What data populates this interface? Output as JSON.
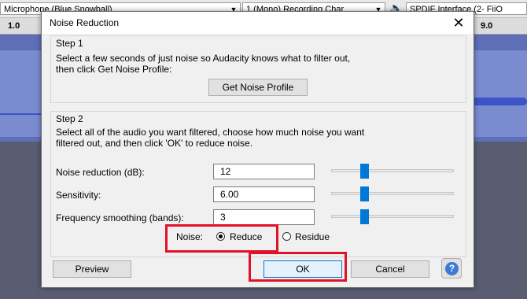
{
  "background": {
    "mic_combo": "Microphone (Blue Snowball)",
    "channels_combo": "1 (Mono) Recording Char",
    "output_combo": "SPDIF Interface (2- FiiO",
    "ruler_left": "1.0",
    "ruler_right": "9.0"
  },
  "dialog": {
    "title": "Noise Reduction",
    "close_glyph": "✕",
    "step1": {
      "title": "Step 1",
      "line1": "Select a few seconds of just noise so Audacity knows what to filter out,",
      "line2": "then click Get Noise Profile:",
      "button_label": "Get Noise Profile"
    },
    "step2": {
      "title": "Step 2",
      "line1": "Select all of the audio you want filtered, choose how much noise you want",
      "line2": "filtered out, and then click 'OK' to reduce noise.",
      "fields": [
        {
          "label": "Noise reduction (dB):",
          "value": "12",
          "slider_fraction": 0.27
        },
        {
          "label": "Sensitivity:",
          "value": "6.00",
          "slider_fraction": 0.27
        },
        {
          "label": "Frequency smoothing (bands):",
          "value": "3",
          "slider_fraction": 0.27
        }
      ],
      "noise_label": "Noise:",
      "noise_options": [
        {
          "label": "Reduce",
          "checked": true
        },
        {
          "label": "Residue",
          "checked": false
        }
      ]
    },
    "buttons": {
      "preview": "Preview",
      "ok": "OK",
      "cancel": "Cancel",
      "help": "?"
    }
  },
  "colors": {
    "highlight": "#e0112b",
    "slider_thumb": "#0078d7",
    "help_icon": "#3c7ad3"
  }
}
